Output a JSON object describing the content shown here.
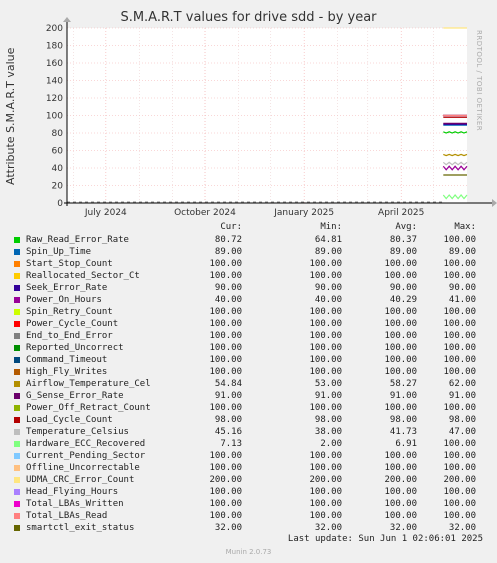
{
  "vendor": "RRDTOOL / TOBI OETIKER",
  "footer": {
    "last_update": "Last update: Sun Jun  1 02:06:01 2025",
    "munin": "Munin 2.0.73"
  },
  "legend_header": {
    "cur": "Cur:",
    "min": "Min:",
    "avg": "Avg:",
    "max": "Max:"
  },
  "chart_data": {
    "type": "line",
    "title": "S.M.A.R.T values for drive sdd - by year",
    "ylabel": "Attribute S.M.A.R.T value",
    "ylim": [
      0,
      200
    ],
    "yticks": [
      0,
      20,
      40,
      60,
      80,
      100,
      120,
      140,
      160,
      180,
      200
    ],
    "xlim": [
      "2024-05-26",
      "2025-06-01"
    ],
    "xticks": [
      {
        "label": "July 2024",
        "date": "2024-07-01"
      },
      {
        "label": "October 2024",
        "date": "2024-10-01"
      },
      {
        "label": "January 2025",
        "date": "2025-01-01"
      },
      {
        "label": "April 2025",
        "date": "2025-04-01"
      }
    ],
    "data_start": "2025-05-10",
    "grid": true,
    "series": [
      {
        "name": "Raw_Read_Error_Rate",
        "color": "#00cc00",
        "cur": "80.72",
        "min": "64.81",
        "avg": "80.37",
        "max": "100.00",
        "value": 80.72
      },
      {
        "name": "Spin_Up_Time",
        "color": "#0066b3",
        "cur": "89.00",
        "min": "89.00",
        "avg": "89.00",
        "max": "89.00",
        "value": 89.0
      },
      {
        "name": "Start_Stop_Count",
        "color": "#ff8000",
        "cur": "100.00",
        "min": "100.00",
        "avg": "100.00",
        "max": "100.00",
        "value": 100.0
      },
      {
        "name": "Reallocated_Sector_Ct",
        "color": "#ffcc00",
        "cur": "100.00",
        "min": "100.00",
        "avg": "100.00",
        "max": "100.00",
        "value": 100.0
      },
      {
        "name": "Seek_Error_Rate",
        "color": "#330099",
        "cur": "90.00",
        "min": "90.00",
        "avg": "90.00",
        "max": "90.00",
        "value": 90.0
      },
      {
        "name": "Power_On_Hours",
        "color": "#990099",
        "cur": "40.00",
        "min": "40.00",
        "avg": "40.29",
        "max": "41.00",
        "value": 40.0
      },
      {
        "name": "Spin_Retry_Count",
        "color": "#ccff00",
        "cur": "100.00",
        "min": "100.00",
        "avg": "100.00",
        "max": "100.00",
        "value": 100.0
      },
      {
        "name": "Power_Cycle_Count",
        "color": "#ff0000",
        "cur": "100.00",
        "min": "100.00",
        "avg": "100.00",
        "max": "100.00",
        "value": 100.0
      },
      {
        "name": "End_to_End_Error",
        "color": "#808080",
        "cur": "100.00",
        "min": "100.00",
        "avg": "100.00",
        "max": "100.00",
        "value": 100.0
      },
      {
        "name": "Reported_Uncorrect",
        "color": "#008f00",
        "cur": "100.00",
        "min": "100.00",
        "avg": "100.00",
        "max": "100.00",
        "value": 100.0
      },
      {
        "name": "Command_Timeout",
        "color": "#00487d",
        "cur": "100.00",
        "min": "100.00",
        "avg": "100.00",
        "max": "100.00",
        "value": 100.0
      },
      {
        "name": "High_Fly_Writes",
        "color": "#b35a00",
        "cur": "100.00",
        "min": "100.00",
        "avg": "100.00",
        "max": "100.00",
        "value": 100.0
      },
      {
        "name": "Airflow_Temperature_Cel",
        "color": "#b38f00",
        "cur": "54.84",
        "min": "53.00",
        "avg": "58.27",
        "max": "62.00",
        "value": 54.84
      },
      {
        "name": "G_Sense_Error_Rate",
        "color": "#6b006b",
        "cur": "91.00",
        "min": "91.00",
        "avg": "91.00",
        "max": "91.00",
        "value": 91.0
      },
      {
        "name": "Power_Off_Retract_Count",
        "color": "#8fb300",
        "cur": "100.00",
        "min": "100.00",
        "avg": "100.00",
        "max": "100.00",
        "value": 100.0
      },
      {
        "name": "Load_Cycle_Count",
        "color": "#b30000",
        "cur": "98.00",
        "min": "98.00",
        "avg": "98.00",
        "max": "98.00",
        "value": 98.0
      },
      {
        "name": "Temperature_Celsius",
        "color": "#bebebe",
        "cur": "45.16",
        "min": "38.00",
        "avg": "41.73",
        "max": "47.00",
        "value": 45.16
      },
      {
        "name": "Hardware_ECC_Recovered",
        "color": "#80ff80",
        "cur": "7.13",
        "min": "2.00",
        "avg": "6.91",
        "max": "100.00",
        "value": 7.13
      },
      {
        "name": "Current_Pending_Sector",
        "color": "#80c9ff",
        "cur": "100.00",
        "min": "100.00",
        "avg": "100.00",
        "max": "100.00",
        "value": 100.0
      },
      {
        "name": "Offline_Uncorrectable",
        "color": "#ffc080",
        "cur": "100.00",
        "min": "100.00",
        "avg": "100.00",
        "max": "100.00",
        "value": 100.0
      },
      {
        "name": "UDMA_CRC_Error_Count",
        "color": "#ffe680",
        "cur": "200.00",
        "min": "200.00",
        "avg": "200.00",
        "max": "200.00",
        "value": 200.0
      },
      {
        "name": "Head_Flying_Hours",
        "color": "#aa80ff",
        "cur": "100.00",
        "min": "100.00",
        "avg": "100.00",
        "max": "100.00",
        "value": 100.0
      },
      {
        "name": "Total_LBAs_Written",
        "color": "#ee00cc",
        "cur": "100.00",
        "min": "100.00",
        "avg": "100.00",
        "max": "100.00",
        "value": 100.0
      },
      {
        "name": "Total_LBAs_Read",
        "color": "#ff8080",
        "cur": "100.00",
        "min": "100.00",
        "avg": "100.00",
        "max": "100.00",
        "value": 100.0
      },
      {
        "name": "smartctl_exit_status",
        "color": "#666600",
        "cur": "32.00",
        "min": "32.00",
        "avg": "32.00",
        "max": "32.00",
        "value": 32.0
      }
    ]
  }
}
